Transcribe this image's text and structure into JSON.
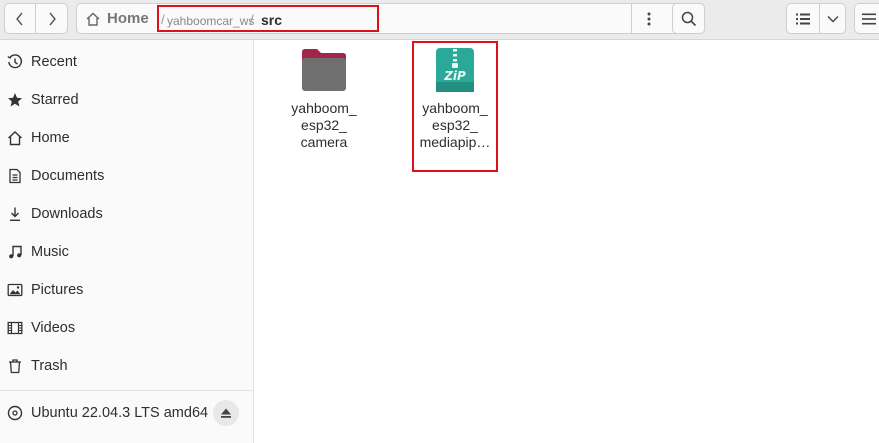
{
  "header": {
    "home_label": "Home",
    "path_separator": "/",
    "path_parent": "yahboomcar_ws",
    "path_current": "src"
  },
  "sidebar": {
    "items": [
      {
        "label": "Recent",
        "icon": "recent-icon"
      },
      {
        "label": "Starred",
        "icon": "star-icon"
      },
      {
        "label": "Home",
        "icon": "home-icon"
      },
      {
        "label": "Documents",
        "icon": "document-icon"
      },
      {
        "label": "Downloads",
        "icon": "download-icon"
      },
      {
        "label": "Music",
        "icon": "music-icon"
      },
      {
        "label": "Pictures",
        "icon": "picture-icon"
      },
      {
        "label": "Videos",
        "icon": "video-icon"
      },
      {
        "label": "Trash",
        "icon": "trash-icon"
      }
    ],
    "drive": {
      "label": "Ubuntu 22.04.3 LTS amd64",
      "icon": "disc-icon"
    }
  },
  "files": [
    {
      "line1": "yahboom_",
      "line2": "esp32_",
      "line3": "camera",
      "type": "folder",
      "icon": "folder-icon"
    },
    {
      "line1": "yahboom_",
      "line2": "esp32_",
      "line3": "mediapip…",
      "type": "zip",
      "icon": "zip-icon"
    }
  ],
  "colors": {
    "highlight": "#d9131a",
    "folder_top": "#a3264a",
    "folder_body": "#6f6f6f",
    "zip_bg": "#2aa898"
  }
}
